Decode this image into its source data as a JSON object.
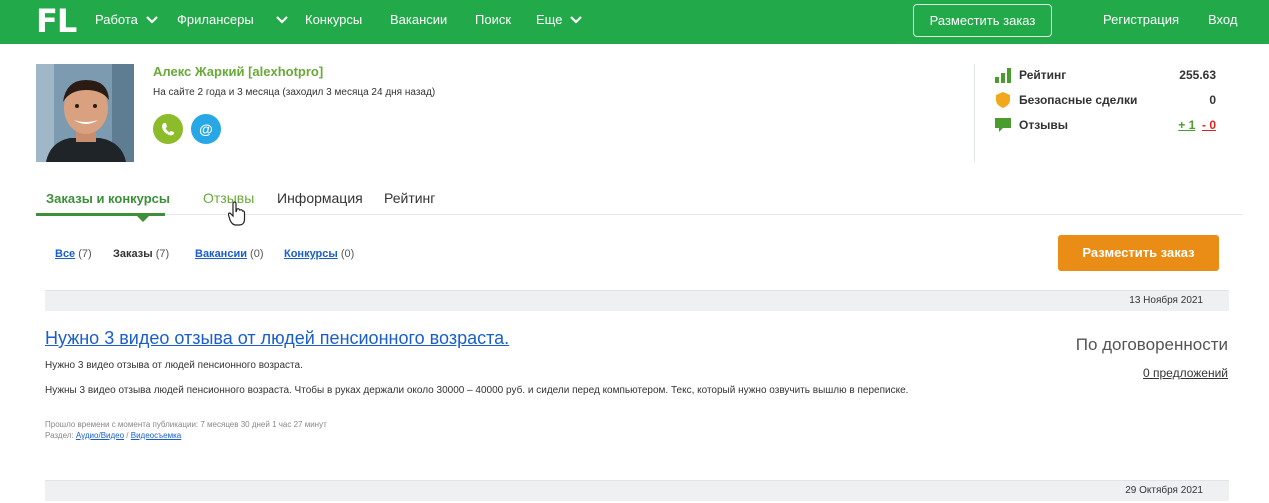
{
  "topnav": {
    "logo": "FL",
    "items": [
      "Работа",
      "Фрилансеры",
      "Конкурсы",
      "Вакансии",
      "Поиск",
      "Еще"
    ],
    "place_order": "Разместить заказ",
    "register": "Регистрация",
    "login": "Вход"
  },
  "profile": {
    "name": "Алекс Жаркий [alexhotpro]",
    "since": "На сайте 2 года и 3 месяца (заходил 3 месяца 24 дня назад)",
    "phone_icon": "phone-icon",
    "email_icon": "@"
  },
  "stats": {
    "rating_label": "Рейтинг",
    "rating_value": "255.63",
    "safe_label": "Безопасные сделки",
    "safe_value": "0",
    "reviews_label": "Отзывы",
    "reviews_pos": "+ 1",
    "reviews_neg": "- 0"
  },
  "tabs": [
    "Заказы и конкурсы",
    "Отзывы",
    "Информация",
    "Рейтинг"
  ],
  "filters": {
    "all": "Все",
    "all_count": "(7)",
    "orders": "Заказы",
    "orders_count": "(7)",
    "vacancies": "Вакансии",
    "vacancies_count": "(0)",
    "contests": "Конкурсы",
    "contests_count": "(0)"
  },
  "place_order_button": "Разместить заказ",
  "projects": [
    {
      "date": "13 Ноября 2021",
      "title": "Нужно 3 видео отзыва от людей пенсионного возраста.",
      "subtitle": "Нужно 3 видео отзыва от людей пенсионного возраста.",
      "description": "Нужны 3 видео отзыва людей пенсионного возраста. Чтобы в руках держали около 30000 – 40000 руб. и сидели перед компьютером. Текс, который нужно озвучить вышлю в переписке.",
      "elapsed": "Прошло времени с момента публикации: 7 месяцев 30 дней 1 час 27 минут",
      "section_label": "Раздел:",
      "section_cat": "Аудио/Видео",
      "section_sub": "Видеосъемка",
      "budget": "По договоренности",
      "offers": "0 предложений"
    }
  ],
  "next_date": "29 Октября 2021",
  "colors": {
    "brand_green": "#22a94a",
    "accent_orange": "#ea8d17",
    "link_blue": "#1a5ec9"
  }
}
